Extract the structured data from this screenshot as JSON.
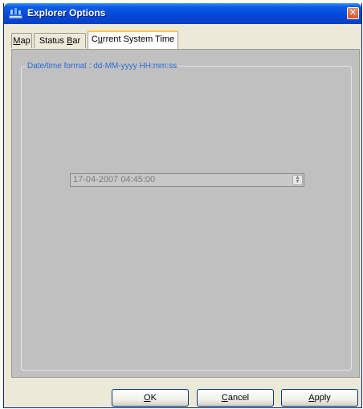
{
  "window": {
    "title": "Explorer Options",
    "close_glyph": "✕",
    "app_icon": "explorer-app-icon",
    "title_color": "#0548d6"
  },
  "tabs": [
    {
      "label_pre": "",
      "mnemonic": "M",
      "label_post": "ap",
      "active": false
    },
    {
      "label_pre": "Status ",
      "mnemonic": "B",
      "label_post": "ar",
      "active": false
    },
    {
      "label_pre": "C",
      "mnemonic": "u",
      "label_post": "rrent System Time",
      "active": true
    }
  ],
  "panel": {
    "legend": "Date/time format :  dd-MM-yyyy HH:mm:ss",
    "legend_color": "#2a6cd8",
    "datetime_value": "17-04-2007 04:45:00",
    "spinner_icon": "spinner-arrows-icon"
  },
  "buttons": {
    "ok": {
      "mnemonic": "O",
      "rest": "K"
    },
    "cancel": {
      "mnemonic": "C",
      "rest": "ancel"
    },
    "apply": {
      "mnemonic": "A",
      "rest": "pply"
    }
  }
}
